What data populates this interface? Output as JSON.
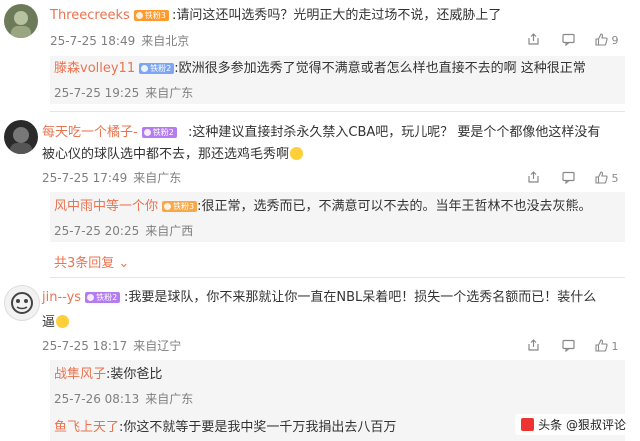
{
  "comments": [
    {
      "user": "Threecreeks",
      "badge": "铁粉3",
      "text": "请问这还叫选秀吗？光明正大的走过场不说，还威胁上了",
      "date": "25-7-25 18:49",
      "location": "来自北京",
      "likes": "9",
      "replies": [
        {
          "user": "滕森volley11",
          "badge": "铁粉2",
          "text": "欧洲很多参加选秀了觉得不满意或者怎么样也直接不去的啊 这种很正常",
          "date": "25-7-25 19:25",
          "location": "来自广东"
        }
      ]
    },
    {
      "user": "每天吃一个橘子-",
      "badge": "铁粉2",
      "text_lines": [
        "这种建议直接封杀永久禁入CBA吧，玩儿呢？ 要是个个都像他这样没有",
        "被心仪的球队选中都不去，那还选鸡毛秀啊"
      ],
      "date": "25-7-25 17:49",
      "location": "来自广东",
      "likes": "5",
      "replies": [
        {
          "user": "风中雨中等一个你",
          "badge": "铁粉3",
          "text": "很正常，选秀而已，不满意可以不去的。当年王哲林不也没去灰熊。",
          "date": "25-7-25 20:25",
          "location": "来自广西"
        }
      ],
      "expand_label": "共3条回复"
    },
    {
      "user": "jin--ys",
      "badge": "铁粉2",
      "text_lines": [
        "我要是球队，你不来那就让你一直在NBL呆着吧！损失一个选秀名额而已！装什么",
        "逼"
      ],
      "date": "25-7-25 18:17",
      "location": "来自辽宁",
      "likes": "1",
      "replies": [
        {
          "user": "战隼风子",
          "text": "装你爸比",
          "date": "25-7-26 08:13",
          "location": "来自广东"
        },
        {
          "user": "鱼飞上天了",
          "text": "你这不就等于要是我中奖一千万我捐出去八百万",
          "date": "",
          "location": ""
        }
      ]
    }
  ],
  "watermark": "头条 @狠叔评论"
}
